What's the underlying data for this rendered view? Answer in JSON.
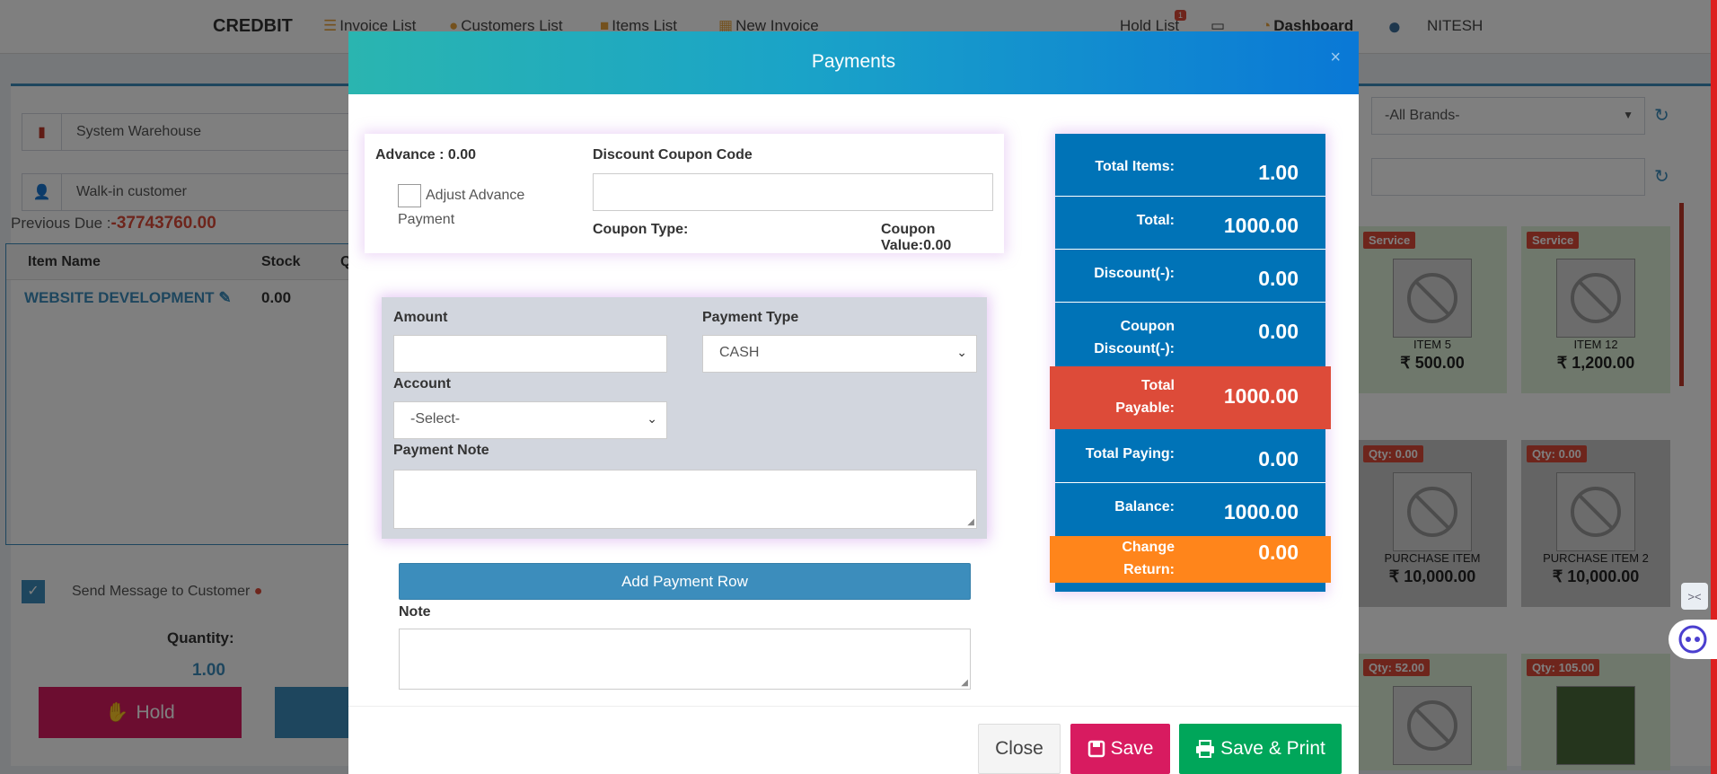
{
  "nav": {
    "brand": "CREDBIT",
    "invoice_list": "Invoice List",
    "customers_list": "Customers List",
    "items_list": "Items List",
    "new_invoice": "New Invoice",
    "hold_list": "Hold List",
    "hold_count": "1",
    "dashboard": "Dashboard",
    "user": "NITESH"
  },
  "pos": {
    "warehouse": "System Warehouse",
    "customer": "Walk-in customer",
    "previous_due_label": "Previous Due :",
    "previous_due_value": "-37743760.00",
    "table_headers": [
      "Item Name",
      "Stock",
      "Q"
    ],
    "row_item": "WEBSITE DEVELOPMENT",
    "row_stock": "0.00",
    "send_message": "Send Message to Customer",
    "quantity_label": "Quantity:",
    "quantity_value": "1.00",
    "hold_label": "Hold"
  },
  "catalog": {
    "brands": "-All Brands-",
    "tiles": [
      {
        "badge": "Service",
        "name": "ITEM 5",
        "price": "₹ 500.00"
      },
      {
        "badge": "Service",
        "name": "ITEM 12",
        "price": "₹ 1,200.00"
      },
      {
        "badge": "Qty: 0.00",
        "name": "PURCHASE ITEM",
        "price": "₹ 10,000.00"
      },
      {
        "badge": "Qty: 0.00",
        "name": "PURCHASE ITEM 2",
        "price": "₹ 10,000.00"
      },
      {
        "badge": "Qty: 52.00",
        "name": "",
        "price": ""
      },
      {
        "badge": "Qty: 105.00",
        "name": "",
        "price": ""
      }
    ]
  },
  "modal": {
    "title": "Payments",
    "close_x": "×",
    "advance_label": "Advance : 0.00",
    "adjust_advance": "Adjust Advance",
    "adjust_advance_2": "Payment",
    "coupon_code_label": "Discount Coupon Code",
    "coupon_type_label": "Coupon Type:",
    "coupon_value_label": "Coupon Value:0.00",
    "amount_label": "Amount",
    "amount_value": "",
    "payment_type_label": "Payment Type",
    "payment_type_value": "CASH",
    "account_label": "Account",
    "account_value": "-Select-",
    "payment_note_label": "Payment Note",
    "add_payment_row": "Add Payment Row",
    "note_label": "Note",
    "close_button": "Close",
    "save_button": "Save",
    "save_print_button": "Save & Print"
  },
  "summary": {
    "total_items_label": "Total Items:",
    "total_items_value": "1.00",
    "total_label": "Total:",
    "total_value": "1000.00",
    "discount_label": "Discount(-):",
    "discount_value": "0.00",
    "coupon_discount_label_1": "Coupon",
    "coupon_discount_label_2": "Discount(-):",
    "coupon_discount_value": "0.00",
    "total_payable_label_1": "Total",
    "total_payable_label_2": "Payable:",
    "total_payable_value": "1000.00",
    "total_paying_label": "Total Paying:",
    "total_paying_value": "0.00",
    "balance_label": "Balance:",
    "balance_value": "1000.00",
    "change_return_label_1": "Change",
    "change_return_label_2": "Return:",
    "change_return_value": "0.00"
  },
  "colors": {
    "primary": "#3c8dbc",
    "summary_bg": "#0073b7",
    "payable_red": "#dd4b39",
    "change_orange": "#ff851b",
    "save_pink": "#d81b60",
    "save_print_green": "#00a65a"
  }
}
